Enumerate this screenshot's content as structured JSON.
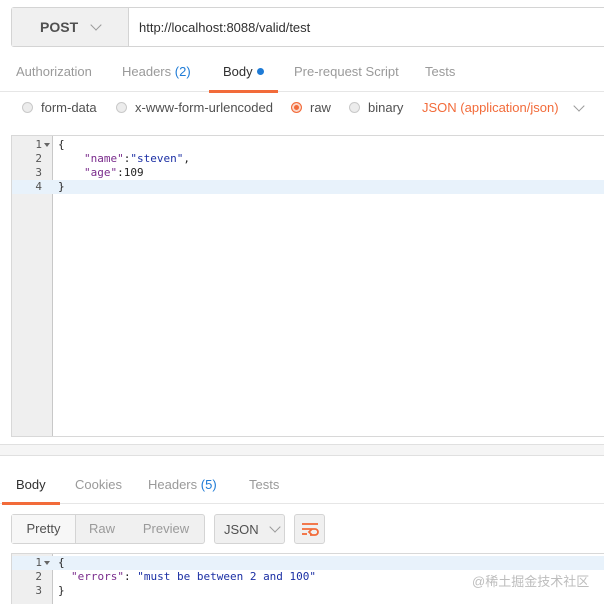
{
  "request": {
    "method": "POST",
    "url": "http://localhost:8088/valid/test"
  },
  "request_tabs": [
    {
      "label": "Authorization"
    },
    {
      "label": "Headers",
      "count": "(2)"
    },
    {
      "label": "Body"
    },
    {
      "label": "Pre-request Script"
    },
    {
      "label": "Tests"
    }
  ],
  "body_options": {
    "form_data": "form-data",
    "urlencoded": "x-www-form-urlencoded",
    "raw": "raw",
    "binary": "binary",
    "selected": "raw",
    "content_type": "JSON (application/json)"
  },
  "request_body": {
    "line_numbers": [
      "1",
      "2",
      "3",
      "4"
    ],
    "open_brace": "{",
    "name_key": "\"name\"",
    "name_value": "\"steven\"",
    "age_key": "\"age\"",
    "age_value": "109",
    "close_brace": "}"
  },
  "response_tabs": [
    {
      "label": "Body"
    },
    {
      "label": "Cookies"
    },
    {
      "label": "Headers",
      "count": "(5)"
    },
    {
      "label": "Tests"
    }
  ],
  "response_toolbar": {
    "pretty": "Pretty",
    "raw": "Raw",
    "preview": "Preview",
    "format": "JSON"
  },
  "response_body": {
    "line_numbers": [
      "1",
      "2",
      "3"
    ],
    "open_brace": "{",
    "errors_key": "\"errors\"",
    "errors_value": "\"must be between 2 and 100\"",
    "close_brace": "}"
  },
  "watermark": "@稀土掘金技术社区",
  "colors": {
    "accent": "#f26b3a",
    "link_blue": "#1e7bd6"
  }
}
